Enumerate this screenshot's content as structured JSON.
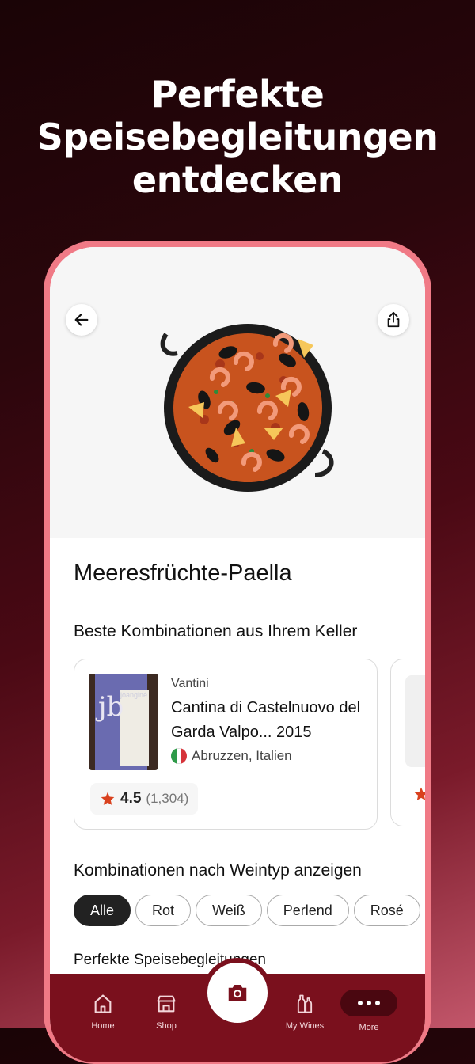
{
  "headline": "Perfekte Speisebegleitungen entdecken",
  "dish": {
    "title": "Meeresfrüchte-Paella"
  },
  "sections": {
    "cellar": "Beste Kombinationen aus Ihrem Keller",
    "by_type": "Kombinationen nach Weintyp anzeigen",
    "perfect": "Perfekte Speisebegleitungen"
  },
  "wine_card": {
    "producer": "Vantini",
    "name": "Cantina di Castelnuovo del Garda Valpo... 2015",
    "region": "Abruzzen, Italien",
    "rating": "4.5",
    "rating_count": "(1,304)",
    "bottle_label_brand": "joanginé",
    "bottle_label_mark": "jb"
  },
  "filters": [
    "Alle",
    "Rot",
    "Weiß",
    "Perlend",
    "Rosé"
  ],
  "active_filter": "Alle",
  "nav": {
    "home": "Home",
    "shop": "Shop",
    "wines": "My Wines",
    "more": "More"
  },
  "colors": {
    "nav_bg": "#7a101d",
    "phone_frame": "#f07a86",
    "star": "#d9411e"
  },
  "icons": {
    "back": "arrow-left-icon",
    "share": "share-icon",
    "camera": "camera-icon",
    "star": "star-icon"
  }
}
